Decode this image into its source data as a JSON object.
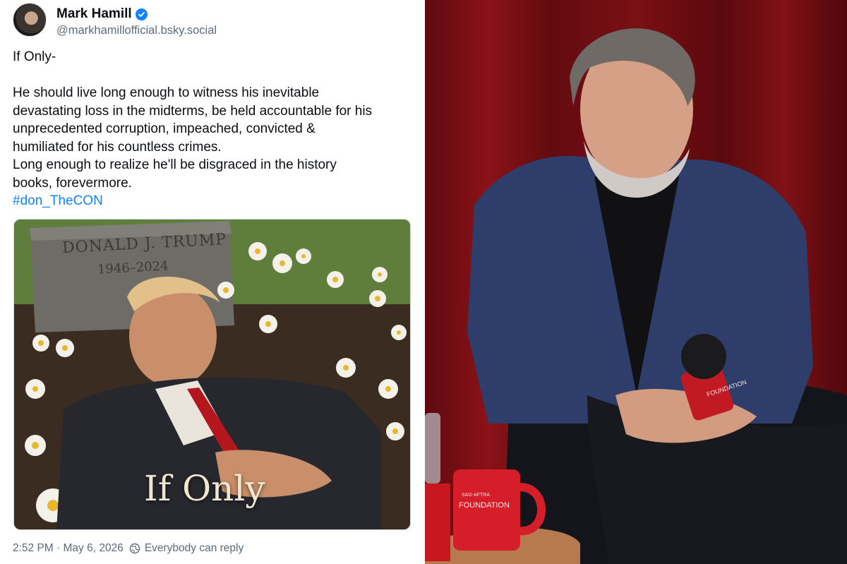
{
  "post": {
    "author": {
      "display_name": "Mark Hamill",
      "handle": "@markhamillofficial.bsky.social",
      "verified": true
    },
    "text": {
      "line1": "If Only-",
      "paragraph": "He should live long enough to witness his inevitable\ndevastating loss in the midterms, be held accountable for his\nunprecedented corruption, impeached, convicted &\nhumiliated for his countless crimes.\nLong enough to realize he'll be disgraced in the history\nbooks, forevermore.",
      "hashtag": "#don_TheCON"
    },
    "image": {
      "tombstone_name": "DONALD J. TRUMP",
      "tombstone_years": "1946–2024",
      "caption": "If Only"
    },
    "meta": {
      "timestamp": "2:52 PM · May 6, 2026",
      "reply_setting": "Everybody can reply",
      "reply_icon": "globe-icon"
    }
  },
  "photo": {
    "microphone_label": "FOUNDATION",
    "mug_label": "FOUNDATION",
    "mug_small_label": "SAG-AFTRA"
  },
  "colors": {
    "link": "#1083fe",
    "muted": "#5b6b7b",
    "curtain": "#7d0f14"
  }
}
